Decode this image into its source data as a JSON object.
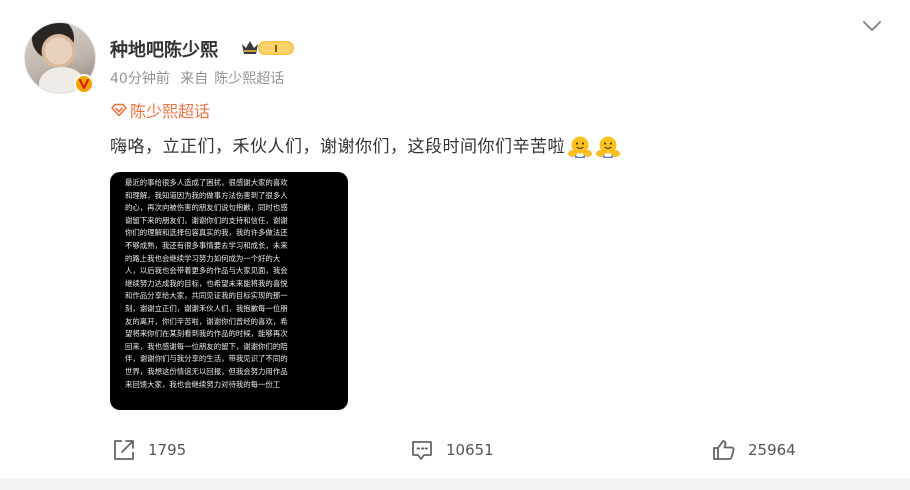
{
  "user": {
    "name": "种地吧陈少熙",
    "level": "I"
  },
  "meta": {
    "time": "40分钟前",
    "source_prefix": "来自",
    "source": "陈少熙超话"
  },
  "topic": {
    "label": "陈少熙超话"
  },
  "post": {
    "text": "嗨咯，立正们，禾伙人们，谢谢你们，这段时间你们辛苦啦",
    "emoji": [
      "hug-emoji",
      "hug-emoji"
    ]
  },
  "image_text": [
    "最近的事给很多人造成了困扰，很感谢大家的喜欢",
    "和理解，我知道因为我的做事方法伤害到了很多人",
    "的心，再次向被伤害的朋友们说句抱歉，同时也感",
    "谢留下来的朋友们，谢谢你们的支持和信任，谢谢",
    "你们的理解和选择包容真实的我，我的许多做法还",
    "不够成熟，我还有很多事情要去学习和成长，未来",
    "的路上我也会继续学习努力如何成为一个好的大",
    "人，以后我也会带着更多的作品与大家见面，我会",
    "继续努力达成我的目标，也希望未来能将我的喜悦",
    "和作品分享给大家，共同见证我的目标实现的那一",
    "刻，谢谢立正们，谢谢禾伙人们，我抱歉每一位朋",
    "友的离开，你们辛苦啦，谢谢你们曾经的喜欢，希",
    "望将来你们在某刻看到我的作品的时候，能够再次",
    "回来，我也感谢每一位朋友的留下，谢谢你们的陪",
    "伴，谢谢你们与我分享的生活，带我见识了不同的",
    "世界，我想这份情谊无以回报，但我会努力用作品",
    "来回馈大家，我也会继续努力对待我的每一份工"
  ],
  "actions": {
    "share_count": "1795",
    "comment_count": "10651",
    "like_count": "25964"
  },
  "colors": {
    "topic": "#eb7340",
    "badge": "#f5a200"
  }
}
